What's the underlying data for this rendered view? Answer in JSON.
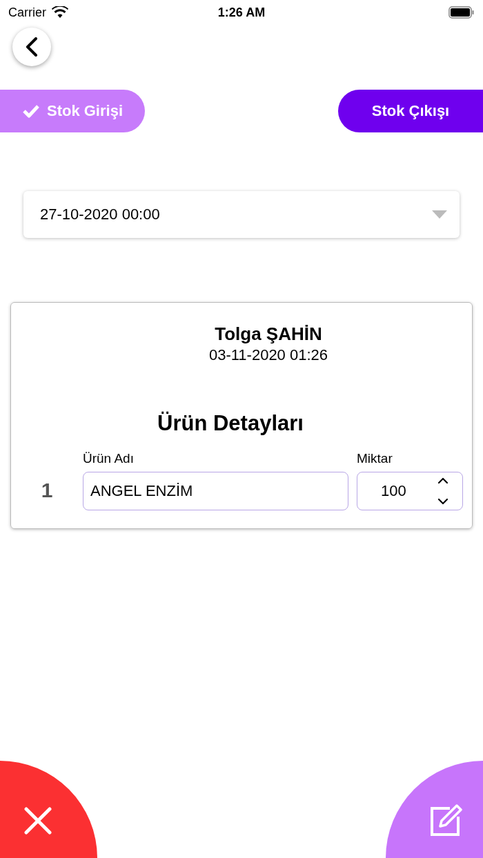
{
  "status_bar": {
    "carrier": "Carrier",
    "time": "1:26 AM"
  },
  "tabs": [
    {
      "label": "Stok Girişi",
      "selected": true
    },
    {
      "label": "Stok Çıkışı",
      "selected": false
    }
  ],
  "date_select": {
    "value": "27-10-2020 00:00"
  },
  "card": {
    "user": "Tolga ŞAHİN",
    "date": "03-11-2020 01:26",
    "heading": "Ürün Detayları",
    "items": [
      {
        "index": "1",
        "name_label": "Ürün Adı",
        "name": "ANGEL ENZİM",
        "qty_label": "Miktar",
        "qty": "100"
      }
    ]
  }
}
